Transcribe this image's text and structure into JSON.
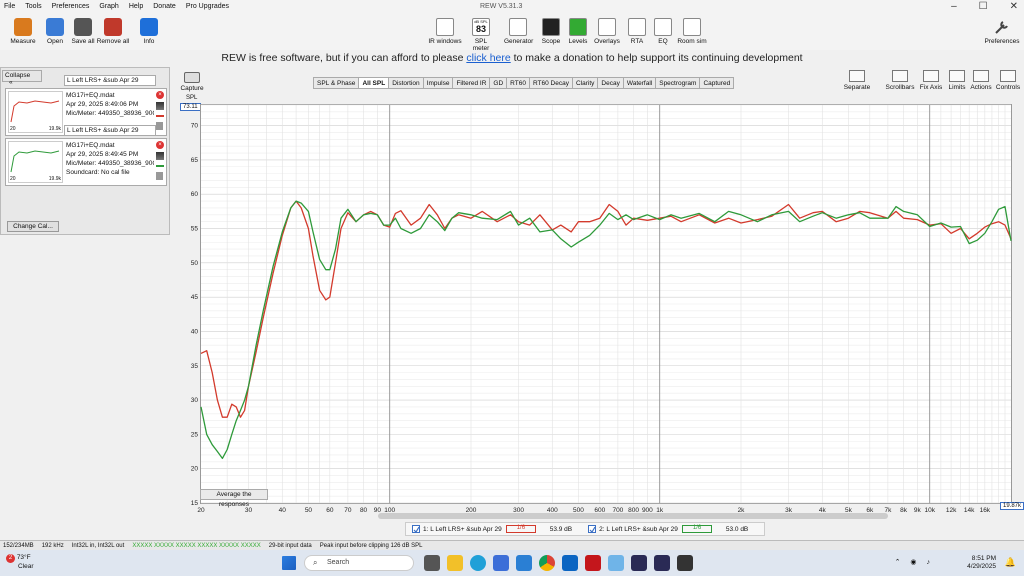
{
  "menu": [
    "File",
    "Tools",
    "Preferences",
    "Graph",
    "Help",
    "Donate",
    "Pro Upgrades"
  ],
  "app_title": "REW V5.31.3",
  "toolbar_left": [
    {
      "label": "Measure",
      "icon": "microphone-icon",
      "color": "#d97a1e"
    },
    {
      "label": "Open",
      "icon": "folder-icon",
      "color": "#3a7bd5"
    },
    {
      "label": "Save all",
      "icon": "save-icon",
      "color": "#555555"
    },
    {
      "label": "Remove all",
      "icon": "remove-icon",
      "color": "#c0392b"
    },
    {
      "label": "Info",
      "icon": "info-icon",
      "color": "#1e6fd9"
    }
  ],
  "toolbar_tools": [
    {
      "label": "IR windows",
      "icon": "ir-windows-icon"
    },
    {
      "label": "SPL meter",
      "icon": "spl-meter-icon",
      "display_top": "dB SPL",
      "display_value": "83"
    },
    {
      "label": "Generator",
      "icon": "generator-icon"
    },
    {
      "label": "Scope",
      "icon": "scope-icon"
    },
    {
      "label": "Levels",
      "icon": "levels-icon"
    },
    {
      "label": "Overlays",
      "icon": "overlays-icon"
    },
    {
      "label": "RTA",
      "icon": "rta-icon"
    },
    {
      "label": "EQ",
      "icon": "eq-icon"
    },
    {
      "label": "Room sim",
      "icon": "room-sim-icon"
    }
  ],
  "preferences_label": "Preferences",
  "banner": {
    "before": "REW is free software, but if you can afford to please ",
    "link": "click here",
    "after": " to make a donation to help support its continuing development"
  },
  "left_panel": {
    "collapse_label": "Collapse",
    "collapse_chevron": "«",
    "measurements": [
      {
        "name": "L Left LRS+ &sub Apr 29",
        "file": "MG17i+EQ.mdat",
        "date": "Apr 29, 2025 8:49:06 PM",
        "mic": "Mic/Meter: 449350_38936_90Gr",
        "soundcard": "",
        "color": "#d33a2c",
        "thumb_labels": [
          "20",
          "19.9k"
        ]
      },
      {
        "name": "L Left LRS+ &sub Apr 29",
        "file": "MG17i+EQ.mdat",
        "date": "Apr 29, 2025 8:49:45 PM",
        "mic": "Mic/Meter: 449350_38936_90Gr",
        "soundcard": "Soundcard: No cal file",
        "color": "#2e9a3a",
        "thumb_labels": [
          "20",
          "19.9k"
        ]
      }
    ],
    "change_cal_label": "Change Cal..."
  },
  "capture_label": "Capture",
  "tabs": [
    {
      "label": "SPL & Phase",
      "active": false
    },
    {
      "label": "All SPL",
      "active": true
    },
    {
      "label": "Distortion",
      "active": false
    },
    {
      "label": "Impulse",
      "active": false
    },
    {
      "label": "Filtered IR",
      "active": false
    },
    {
      "label": "GD",
      "active": false
    },
    {
      "label": "RT60",
      "active": false
    },
    {
      "label": "RT60 Decay",
      "active": false
    },
    {
      "label": "Clarity",
      "active": false
    },
    {
      "label": "Decay",
      "active": false
    },
    {
      "label": "Waterfall",
      "active": false
    },
    {
      "label": "Spectrogram",
      "active": false
    },
    {
      "label": "Captured",
      "active": false
    }
  ],
  "right_tools": [
    {
      "label": "Separate",
      "icon": "separate-icon"
    },
    {
      "label": "Scrollbars",
      "icon": "scrollbars-icon"
    },
    {
      "label": "Fix Axis",
      "icon": "fix-axis-icon"
    },
    {
      "label": "Limits",
      "icon": "limits-icon"
    },
    {
      "label": "Actions",
      "icon": "actions-icon"
    },
    {
      "label": "Controls",
      "icon": "controls-icon"
    }
  ],
  "spl_unit": "SPL",
  "y_top_readout": "73.11",
  "x_right_readout": "19.87k",
  "average_button": "Average the responses",
  "chart_data": {
    "type": "line",
    "x_scale": "log",
    "xlim": [
      20,
      20000
    ],
    "ylim": [
      15,
      73
    ],
    "yticks": [
      15,
      20,
      25,
      30,
      35,
      40,
      45,
      50,
      55,
      60,
      65,
      70
    ],
    "xticks": [
      {
        "v": 20,
        "l": "20"
      },
      {
        "v": 30,
        "l": "30"
      },
      {
        "v": 40,
        "l": "40"
      },
      {
        "v": 50,
        "l": "50"
      },
      {
        "v": 60,
        "l": "60"
      },
      {
        "v": 70,
        "l": "70"
      },
      {
        "v": 80,
        "l": "80"
      },
      {
        "v": 90,
        "l": "90"
      },
      {
        "v": 100,
        "l": "100"
      },
      {
        "v": 200,
        "l": "200"
      },
      {
        "v": 300,
        "l": "300"
      },
      {
        "v": 400,
        "l": "400"
      },
      {
        "v": 500,
        "l": "500"
      },
      {
        "v": 600,
        "l": "600"
      },
      {
        "v": 700,
        "l": "700"
      },
      {
        "v": 800,
        "l": "800"
      },
      {
        "v": 900,
        "l": "900"
      },
      {
        "v": 1000,
        "l": "1k"
      },
      {
        "v": 2000,
        "l": "2k"
      },
      {
        "v": 3000,
        "l": "3k"
      },
      {
        "v": 4000,
        "l": "4k"
      },
      {
        "v": 5000,
        "l": "5k"
      },
      {
        "v": 6000,
        "l": "6k"
      },
      {
        "v": 7000,
        "l": "7k"
      },
      {
        "v": 8000,
        "l": "8k"
      },
      {
        "v": 9000,
        "l": "9k"
      },
      {
        "v": 10000,
        "l": "10k"
      },
      {
        "v": 12000,
        "l": "12k"
      },
      {
        "v": 14000,
        "l": "14k"
      },
      {
        "v": 16000,
        "l": "16k"
      }
    ],
    "grid": true,
    "series": [
      {
        "name": "1: L Left LRS+ &sub Apr 29",
        "color": "#d33a2c",
        "points": [
          [
            20,
            36.8
          ],
          [
            21,
            37.2
          ],
          [
            22,
            34
          ],
          [
            23,
            30
          ],
          [
            24,
            27.5
          ],
          [
            25,
            27.5
          ],
          [
            26,
            29.4
          ],
          [
            27,
            29
          ],
          [
            28,
            27.5
          ],
          [
            29,
            28.5
          ],
          [
            30,
            32
          ],
          [
            32,
            37
          ],
          [
            34,
            42
          ],
          [
            37,
            48.5
          ],
          [
            40,
            54
          ],
          [
            43,
            58
          ],
          [
            45,
            59
          ],
          [
            47,
            58
          ],
          [
            50,
            55
          ],
          [
            52,
            51
          ],
          [
            55,
            46
          ],
          [
            58,
            44.6
          ],
          [
            60,
            45
          ],
          [
            63,
            50
          ],
          [
            66,
            55
          ],
          [
            70,
            57.3
          ],
          [
            75,
            56
          ],
          [
            80,
            57
          ],
          [
            85,
            57.5
          ],
          [
            90,
            57
          ],
          [
            95,
            55.5
          ],
          [
            100,
            55.2
          ],
          [
            105,
            57.2
          ],
          [
            110,
            57.6
          ],
          [
            120,
            55.5
          ],
          [
            130,
            56.5
          ],
          [
            140,
            58.5
          ],
          [
            150,
            57
          ],
          [
            160,
            55
          ],
          [
            170,
            56.5
          ],
          [
            180,
            57
          ],
          [
            200,
            56.5
          ],
          [
            220,
            57.5
          ],
          [
            250,
            56
          ],
          [
            280,
            57
          ],
          [
            300,
            56
          ],
          [
            330,
            55.5
          ],
          [
            360,
            57
          ],
          [
            400,
            54.8
          ],
          [
            430,
            55.5
          ],
          [
            470,
            54.5
          ],
          [
            500,
            56
          ],
          [
            550,
            56
          ],
          [
            600,
            56.5
          ],
          [
            650,
            58.5
          ],
          [
            700,
            57.5
          ],
          [
            750,
            55.5
          ],
          [
            800,
            56.5
          ],
          [
            900,
            56.2
          ],
          [
            1000,
            56.5
          ],
          [
            1100,
            56.8
          ],
          [
            1200,
            56
          ],
          [
            1400,
            57
          ],
          [
            1600,
            55.8
          ],
          [
            1800,
            56.5
          ],
          [
            2000,
            55.8
          ],
          [
            2300,
            56.3
          ],
          [
            2600,
            56.8
          ],
          [
            3000,
            58.5
          ],
          [
            3300,
            56.5
          ],
          [
            3700,
            57.3
          ],
          [
            4000,
            57.5
          ],
          [
            4500,
            56
          ],
          [
            5000,
            56.5
          ],
          [
            5500,
            57.5
          ],
          [
            6000,
            57.3
          ],
          [
            7000,
            56.5
          ],
          [
            7500,
            57.5
          ],
          [
            8000,
            56.5
          ],
          [
            9000,
            56.3
          ],
          [
            10000,
            55.5
          ],
          [
            11000,
            55.7
          ],
          [
            12000,
            54.3
          ],
          [
            13000,
            55
          ],
          [
            14000,
            53.5
          ],
          [
            15000,
            54.3
          ],
          [
            16000,
            55.2
          ],
          [
            17000,
            55.7
          ],
          [
            18000,
            56
          ],
          [
            19000,
            55.5
          ],
          [
            20000,
            53.5
          ]
        ]
      },
      {
        "name": "2: L Left LRS+ &sub Apr 29",
        "color": "#2e9a3a",
        "points": [
          [
            20,
            29
          ],
          [
            21,
            25
          ],
          [
            22,
            23.5
          ],
          [
            23,
            22.5
          ],
          [
            24,
            21.5
          ],
          [
            25,
            22.8
          ],
          [
            26,
            25
          ],
          [
            27,
            27
          ],
          [
            28,
            28.5
          ],
          [
            29,
            30
          ],
          [
            30,
            32
          ],
          [
            32,
            38
          ],
          [
            34,
            43
          ],
          [
            37,
            49.5
          ],
          [
            40,
            54.5
          ],
          [
            43,
            58
          ],
          [
            45,
            59
          ],
          [
            47,
            58.7
          ],
          [
            50,
            57.5
          ],
          [
            52,
            54.5
          ],
          [
            55,
            50.5
          ],
          [
            58,
            49
          ],
          [
            60,
            49
          ],
          [
            63,
            52
          ],
          [
            66,
            56.5
          ],
          [
            70,
            57.8
          ],
          [
            75,
            56
          ],
          [
            80,
            57
          ],
          [
            85,
            57.2
          ],
          [
            90,
            57
          ],
          [
            95,
            55.5
          ],
          [
            100,
            55.5
          ],
          [
            105,
            56.5
          ],
          [
            110,
            55
          ],
          [
            120,
            54.3
          ],
          [
            130,
            55
          ],
          [
            140,
            57
          ],
          [
            150,
            56
          ],
          [
            160,
            54.7
          ],
          [
            170,
            56.5
          ],
          [
            180,
            57.3
          ],
          [
            200,
            57
          ],
          [
            220,
            56.5
          ],
          [
            250,
            56.3
          ],
          [
            280,
            57.5
          ],
          [
            300,
            55.5
          ],
          [
            330,
            56.5
          ],
          [
            360,
            54.5
          ],
          [
            400,
            54.8
          ],
          [
            430,
            53.5
          ],
          [
            470,
            52.3
          ],
          [
            500,
            53
          ],
          [
            550,
            54
          ],
          [
            600,
            55.5
          ],
          [
            650,
            57.2
          ],
          [
            700,
            56.3
          ],
          [
            750,
            57
          ],
          [
            800,
            56.3
          ],
          [
            900,
            57
          ],
          [
            1000,
            56.3
          ],
          [
            1100,
            57
          ],
          [
            1200,
            56.5
          ],
          [
            1400,
            57.2
          ],
          [
            1600,
            56
          ],
          [
            1800,
            57.5
          ],
          [
            2000,
            57
          ],
          [
            2300,
            56
          ],
          [
            2600,
            57
          ],
          [
            3000,
            57.5
          ],
          [
            3300,
            56
          ],
          [
            3700,
            56.8
          ],
          [
            4000,
            57.3
          ],
          [
            4500,
            56.5
          ],
          [
            5000,
            57
          ],
          [
            5500,
            57.3
          ],
          [
            6000,
            56.5
          ],
          [
            7000,
            56.5
          ],
          [
            7500,
            58.2
          ],
          [
            8000,
            57.5
          ],
          [
            9000,
            57
          ],
          [
            10000,
            55.3
          ],
          [
            11000,
            55.8
          ],
          [
            12000,
            55.2
          ],
          [
            13000,
            55.3
          ],
          [
            14000,
            52.8
          ],
          [
            15000,
            53.3
          ],
          [
            16000,
            54.3
          ],
          [
            17000,
            56
          ],
          [
            18000,
            57.8
          ],
          [
            19000,
            58.2
          ],
          [
            20000,
            53.2
          ]
        ]
      }
    ]
  },
  "legend": [
    {
      "label": "1: L Left LRS+ &sub Apr 29",
      "value": "53.9 dB",
      "color": "#d33a2c",
      "smoothing": "1/6"
    },
    {
      "label": "2: L Left LRS+ &sub Apr 29",
      "value": "53.0 dB",
      "color": "#2e9a3a",
      "smoothing": "1/6"
    }
  ],
  "status": {
    "memory": "152/234MB",
    "rate": "192 kHz",
    "format": "Int32L in, Int32L out",
    "meter": "XXXXX XXXXX XXXXX XXXXX XXXXX XXXXX",
    "input": "29-bit input data",
    "peak": "Peak input before clipping 126 dB SPL"
  },
  "taskbar": {
    "badge": "2",
    "temp": "73°F",
    "weather": "Clear",
    "search": "Search",
    "time": "8:51 PM",
    "date": "4/29/2025"
  }
}
